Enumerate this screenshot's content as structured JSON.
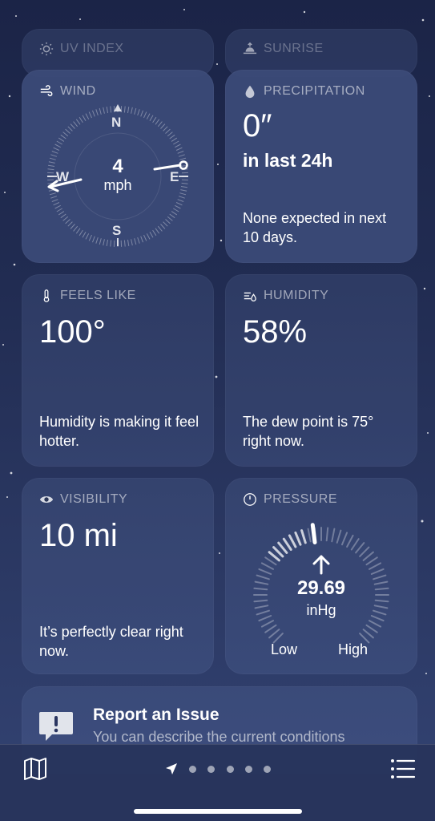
{
  "cards": {
    "uv_index": {
      "title": "UV INDEX"
    },
    "sunrise": {
      "title": "SUNRISE"
    },
    "wind": {
      "title": "WIND",
      "speed": "4",
      "unit": "mph",
      "compass": {
        "n": "N",
        "s": "S",
        "e": "E",
        "w": "W"
      }
    },
    "precipitation": {
      "title": "PRECIPITATION",
      "amount": "0″",
      "period": "in last 24h",
      "description": "None expected in next 10 days."
    },
    "feels_like": {
      "title": "FEELS LIKE",
      "value": "100°",
      "description": "Humidity is making it feel hotter."
    },
    "humidity": {
      "title": "HUMIDITY",
      "value": "58%",
      "description": "The dew point is 75° right now."
    },
    "visibility": {
      "title": "VISIBILITY",
      "value": "10 mi",
      "description": "It’s perfectly clear right now."
    },
    "pressure": {
      "title": "PRESSURE",
      "value": "29.69",
      "unit": "inHg",
      "low_label": "Low",
      "high_label": "High",
      "trend": "rising"
    }
  },
  "report": {
    "title": "Report an Issue",
    "subtitle": "You can describe the current conditions"
  },
  "tabbar": {
    "page_count": 5,
    "current": "location"
  },
  "colors": {
    "background_top": "#1b2447",
    "background_bottom": "#334373",
    "card": "rgba(120,140,200,0.16)"
  }
}
